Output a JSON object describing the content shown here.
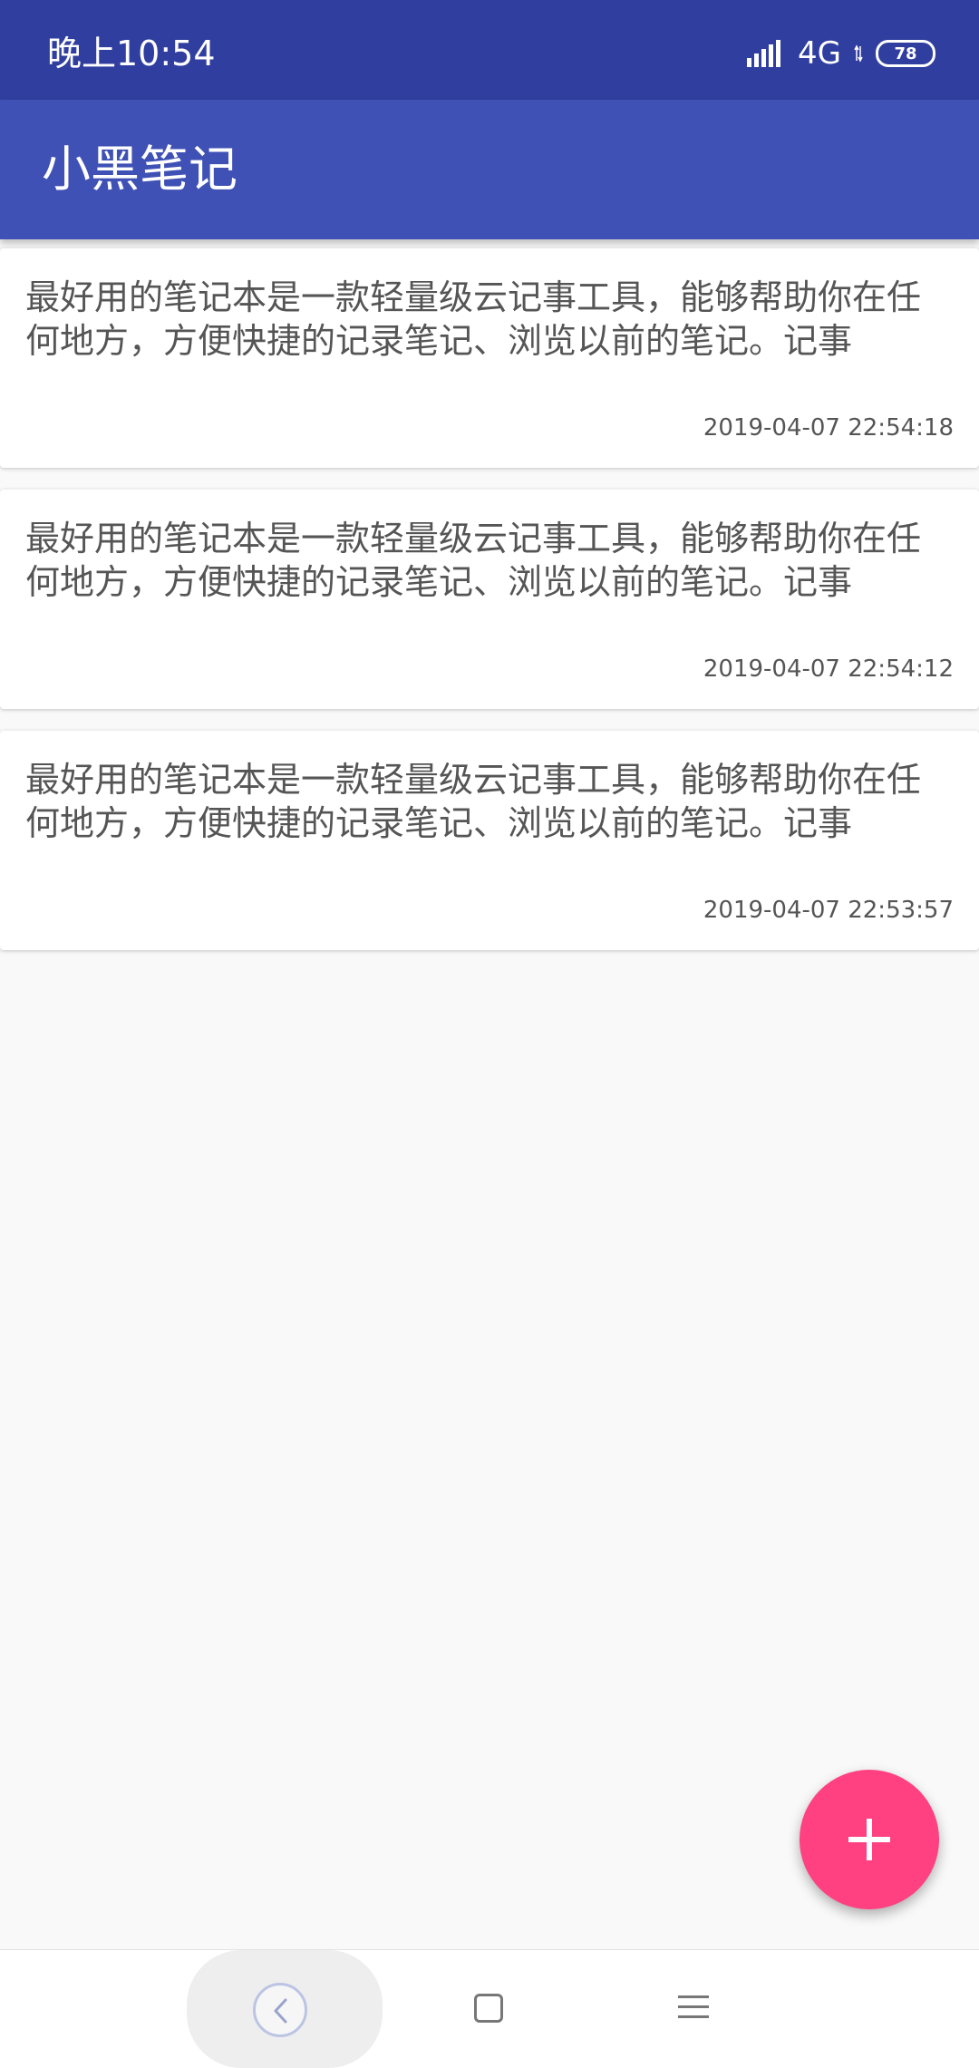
{
  "status_bar": {
    "time": "晚上10:54",
    "network": "4G",
    "battery": "78",
    "signal_icon": "signal-bars-icon"
  },
  "app_bar": {
    "title": "小黑笔记",
    "color": "#3f51b5",
    "status_color": "#303f9f"
  },
  "notes": [
    {
      "text": "最好用的笔记本是一款轻量级云记事工具，能够帮助你在任何地方，方便快捷的记录笔记、浏览以前的笔记。记事",
      "time": "2019-04-07 22:54:18"
    },
    {
      "text": "最好用的笔记本是一款轻量级云记事工具，能够帮助你在任何地方，方便快捷的记录笔记、浏览以前的笔记。记事",
      "time": "2019-04-07 22:54:12"
    },
    {
      "text": "最好用的笔记本是一款轻量级云记事工具，能够帮助你在任何地方，方便快捷的记录笔记、浏览以前的笔记。记事",
      "time": "2019-04-07 22:53:57"
    }
  ],
  "fab": {
    "icon": "plus-icon",
    "color": "#ff4081"
  },
  "nav_bar": {
    "back_icon": "back-icon",
    "home_icon": "home-icon",
    "menu_icon": "menu-icon"
  }
}
